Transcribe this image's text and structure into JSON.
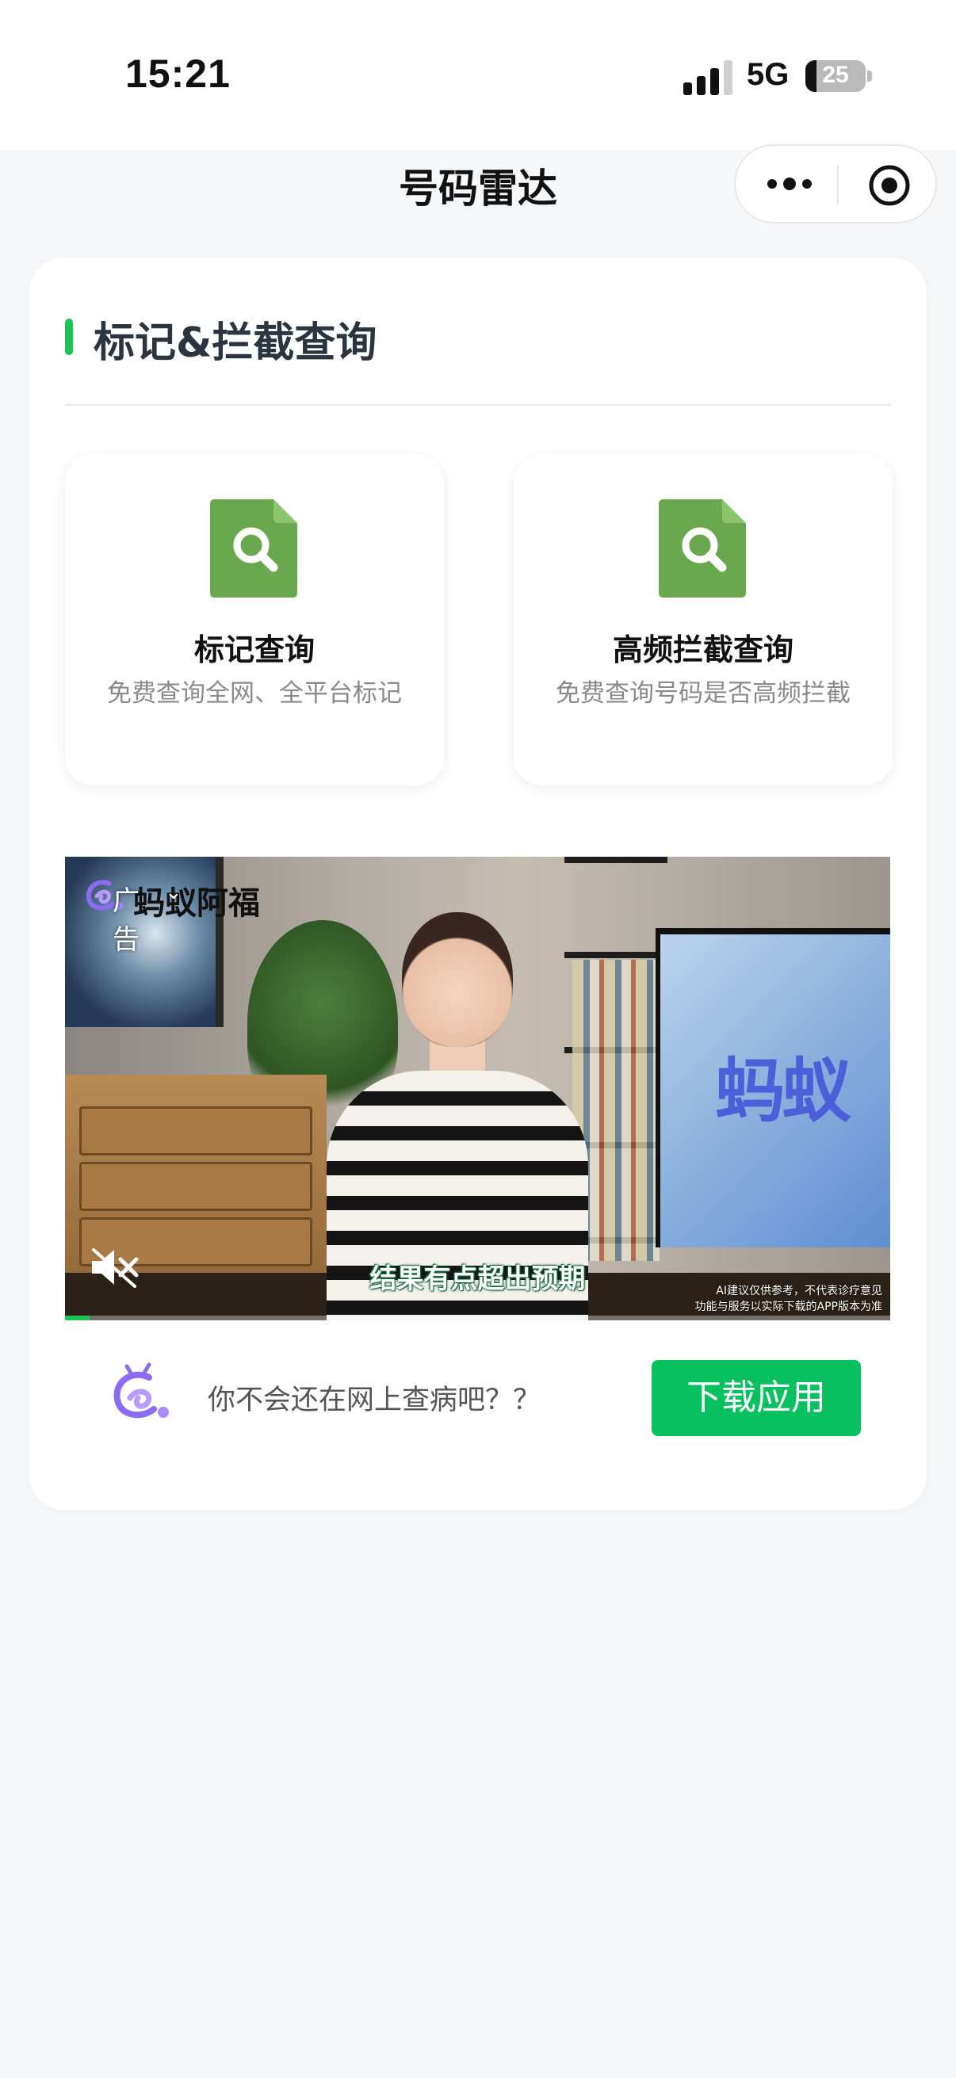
{
  "status_bar": {
    "time": "15:21",
    "network": "5G",
    "battery_level": "25"
  },
  "nav": {
    "title": "号码雷达"
  },
  "section": {
    "title": "标记&拦截查询"
  },
  "tiles": [
    {
      "title": "标记查询",
      "desc": "免费查询全网、全平台标记",
      "icon": "file-search-icon",
      "icon_color": "#6aa84f"
    },
    {
      "title": "高频拦截查询",
      "desc": "免费查询号码是否高频拦截",
      "icon": "file-search-icon",
      "icon_color": "#6aa84f"
    }
  ],
  "ad": {
    "badge": "广告",
    "brand_name": "蚂蚁阿福",
    "tv_logo_text": "蚂蚁",
    "subtitle": "结果有点超出预期",
    "disclaimer_line1": "AI建议仅供参考，不代表诊疗意见",
    "disclaimer_line2": "功能与服务以实际下载的APP版本为准",
    "progress": 0.03,
    "footer_text": "你不会还在网上查病吧？？",
    "cta_label": "下载应用",
    "cta_color": "#07c160"
  },
  "colors": {
    "accent": "#1fc256",
    "background": "#f6f7f8",
    "card": "#ffffff"
  }
}
